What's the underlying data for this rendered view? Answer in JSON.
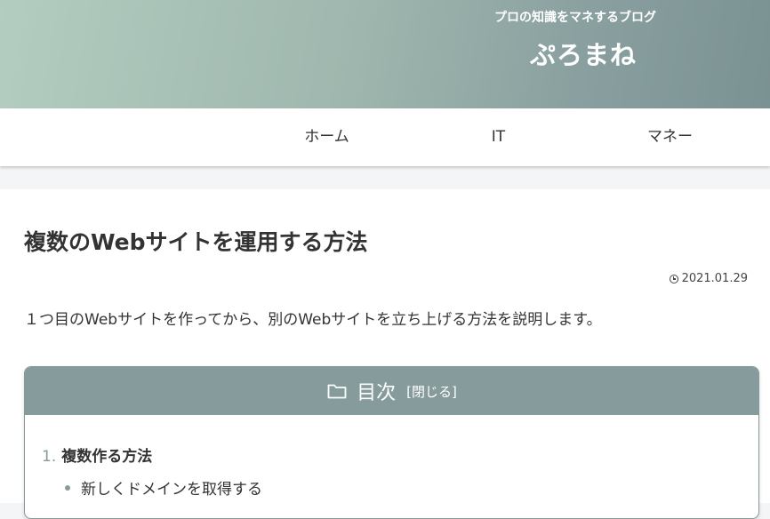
{
  "header": {
    "tagline": "プロの知識をマネするブログ",
    "site_title": "ぷろまね"
  },
  "nav": {
    "items": [
      {
        "label": "ホーム"
      },
      {
        "label": "IT"
      },
      {
        "label": "マネー"
      }
    ]
  },
  "post": {
    "title": "複数のWebサイトを運用する方法",
    "date": "2021.01.29",
    "date_icon": "clock-icon",
    "lead": "１つ目のWebサイトを作ってから、別のWebサイトを立ち上げる方法を説明します。"
  },
  "toc": {
    "icon": "folder-icon",
    "title": "目次",
    "toggle_label": "[閉じる]",
    "items": [
      {
        "number": "1.",
        "label": "複数作る方法",
        "children": [
          {
            "label": "新しくドメインを取得する"
          }
        ]
      }
    ]
  },
  "colors": {
    "accent": "#869b9b",
    "header_gradient_start": "#b3cdc0",
    "header_gradient_end": "#7b9292"
  }
}
